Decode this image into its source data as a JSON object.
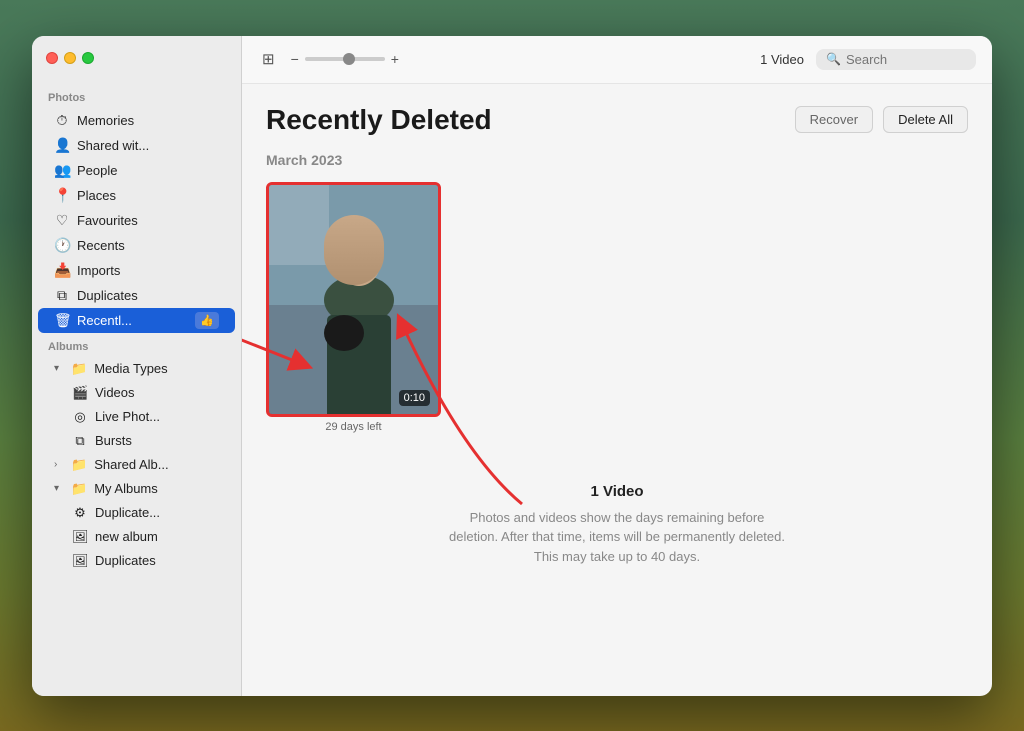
{
  "window": {
    "title": "Photos"
  },
  "sidebar": {
    "sections": [
      {
        "label": "Photos",
        "items": [
          {
            "id": "memories",
            "label": "Memories",
            "icon": "⏱",
            "type": "item"
          },
          {
            "id": "shared-with",
            "label": "Shared wit...",
            "icon": "👤",
            "type": "item"
          },
          {
            "id": "people",
            "label": "People",
            "icon": "👥",
            "type": "item"
          },
          {
            "id": "places",
            "label": "Places",
            "icon": "📍",
            "type": "item"
          },
          {
            "id": "favourites",
            "label": "Favourites",
            "icon": "♡",
            "type": "item"
          },
          {
            "id": "recents",
            "label": "Recents",
            "icon": "🕐",
            "type": "item"
          },
          {
            "id": "imports",
            "label": "Imports",
            "icon": "📥",
            "type": "item"
          },
          {
            "id": "duplicates",
            "label": "Duplicates",
            "icon": "⧉",
            "type": "item"
          },
          {
            "id": "recently-deleted",
            "label": "Recentl...",
            "icon": "🗑",
            "type": "item",
            "active": true,
            "badge": "👍"
          }
        ]
      },
      {
        "label": "Albums",
        "items": [
          {
            "id": "media-types",
            "label": "Media Types",
            "icon": "📁",
            "type": "group",
            "expanded": true,
            "indent": 0
          },
          {
            "id": "videos",
            "label": "Videos",
            "icon": "🎬",
            "type": "sub"
          },
          {
            "id": "live-photos",
            "label": "Live Phot...",
            "icon": "◎",
            "type": "sub"
          },
          {
            "id": "bursts",
            "label": "Bursts",
            "icon": "⧉",
            "type": "sub"
          },
          {
            "id": "shared-albums",
            "label": "Shared Alb...",
            "icon": "📁",
            "type": "group",
            "expanded": false,
            "indent": 0
          },
          {
            "id": "my-albums",
            "label": "My Albums",
            "icon": "📁",
            "type": "group",
            "expanded": true,
            "indent": 0
          },
          {
            "id": "duplicates-album",
            "label": "Duplicate...",
            "icon": "⚙",
            "type": "sub"
          },
          {
            "id": "new-album",
            "label": "new album",
            "icon": "🖼",
            "type": "sub"
          },
          {
            "id": "duplicates2",
            "label": "Duplicates",
            "icon": "🖼",
            "type": "sub"
          }
        ]
      }
    ]
  },
  "toolbar": {
    "zoom_minus": "−",
    "zoom_plus": "+",
    "video_count": "1 Video",
    "search_placeholder": "Search"
  },
  "main": {
    "page_title": "Recently Deleted",
    "recover_label": "Recover",
    "delete_all_label": "Delete All",
    "section_date": "March 2023",
    "media_items": [
      {
        "id": "video-1",
        "duration": "0:10",
        "caption": "29 days left",
        "selected": true
      }
    ],
    "info": {
      "title": "1 Video",
      "description": "Photos and videos show the days remaining before deletion. After that time, items will be permanently deleted. This may take up to 40 days."
    }
  }
}
